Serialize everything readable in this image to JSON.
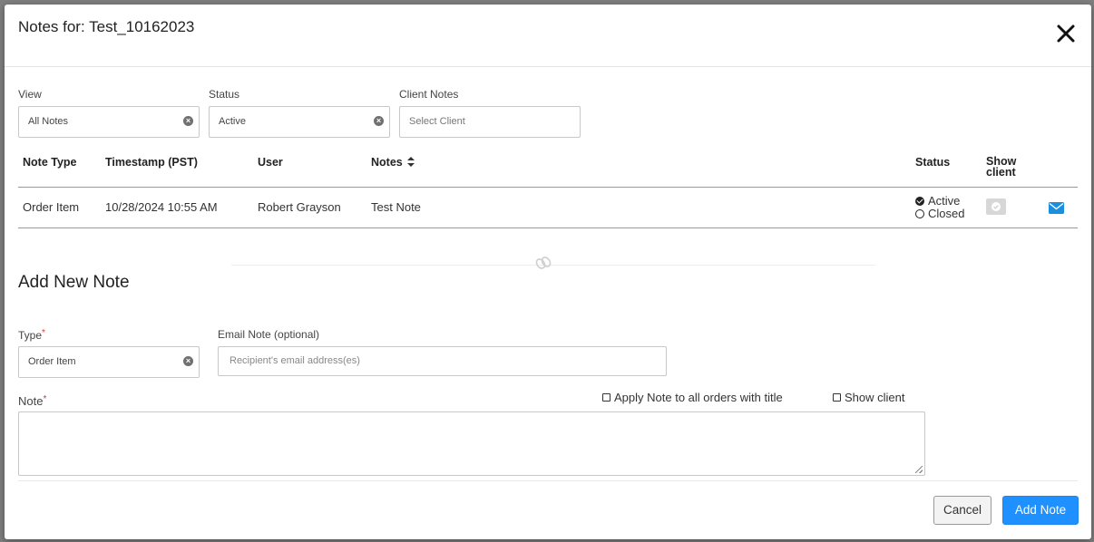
{
  "modal": {
    "title": "Notes for: Test_10162023"
  },
  "filters": {
    "view": {
      "label": "View",
      "value": "All Notes"
    },
    "status": {
      "label": "Status",
      "value": "Active"
    },
    "client_notes": {
      "label": "Client Notes",
      "placeholder": "Select Client"
    }
  },
  "table": {
    "headers": {
      "note_type": "Note Type",
      "timestamp": "Timestamp (PST)",
      "user": "User",
      "notes": "Notes",
      "status": "Status",
      "show_client_1": "Show",
      "show_client_2": "client"
    },
    "rows": [
      {
        "note_type": "Order Item",
        "timestamp": "10/28/2024 10:55 AM",
        "user": "Robert Grayson",
        "notes": "Test Note",
        "status_active": "Active",
        "status_closed": "Closed",
        "selected_status": "Active",
        "show_client": false
      }
    ]
  },
  "add_note": {
    "title": "Add New Note",
    "type_label": "Type",
    "type_value": "Order Item",
    "email_label": "Email Note (optional)",
    "email_placeholder": "Recipient's email address(es)",
    "note_label": "Note",
    "apply_all_label": "Apply Note to all orders with title",
    "show_client_label": "Show client",
    "required_mark": "*"
  },
  "buttons": {
    "cancel": "Cancel",
    "add_note": "Add Note"
  },
  "icons": {
    "close": "close-icon",
    "sort": "sort-icon",
    "mail": "envelope-icon",
    "clear": "clear-circle-icon"
  },
  "colors": {
    "primary": "#1e90ff",
    "mail_icon": "#1a8fe0"
  }
}
